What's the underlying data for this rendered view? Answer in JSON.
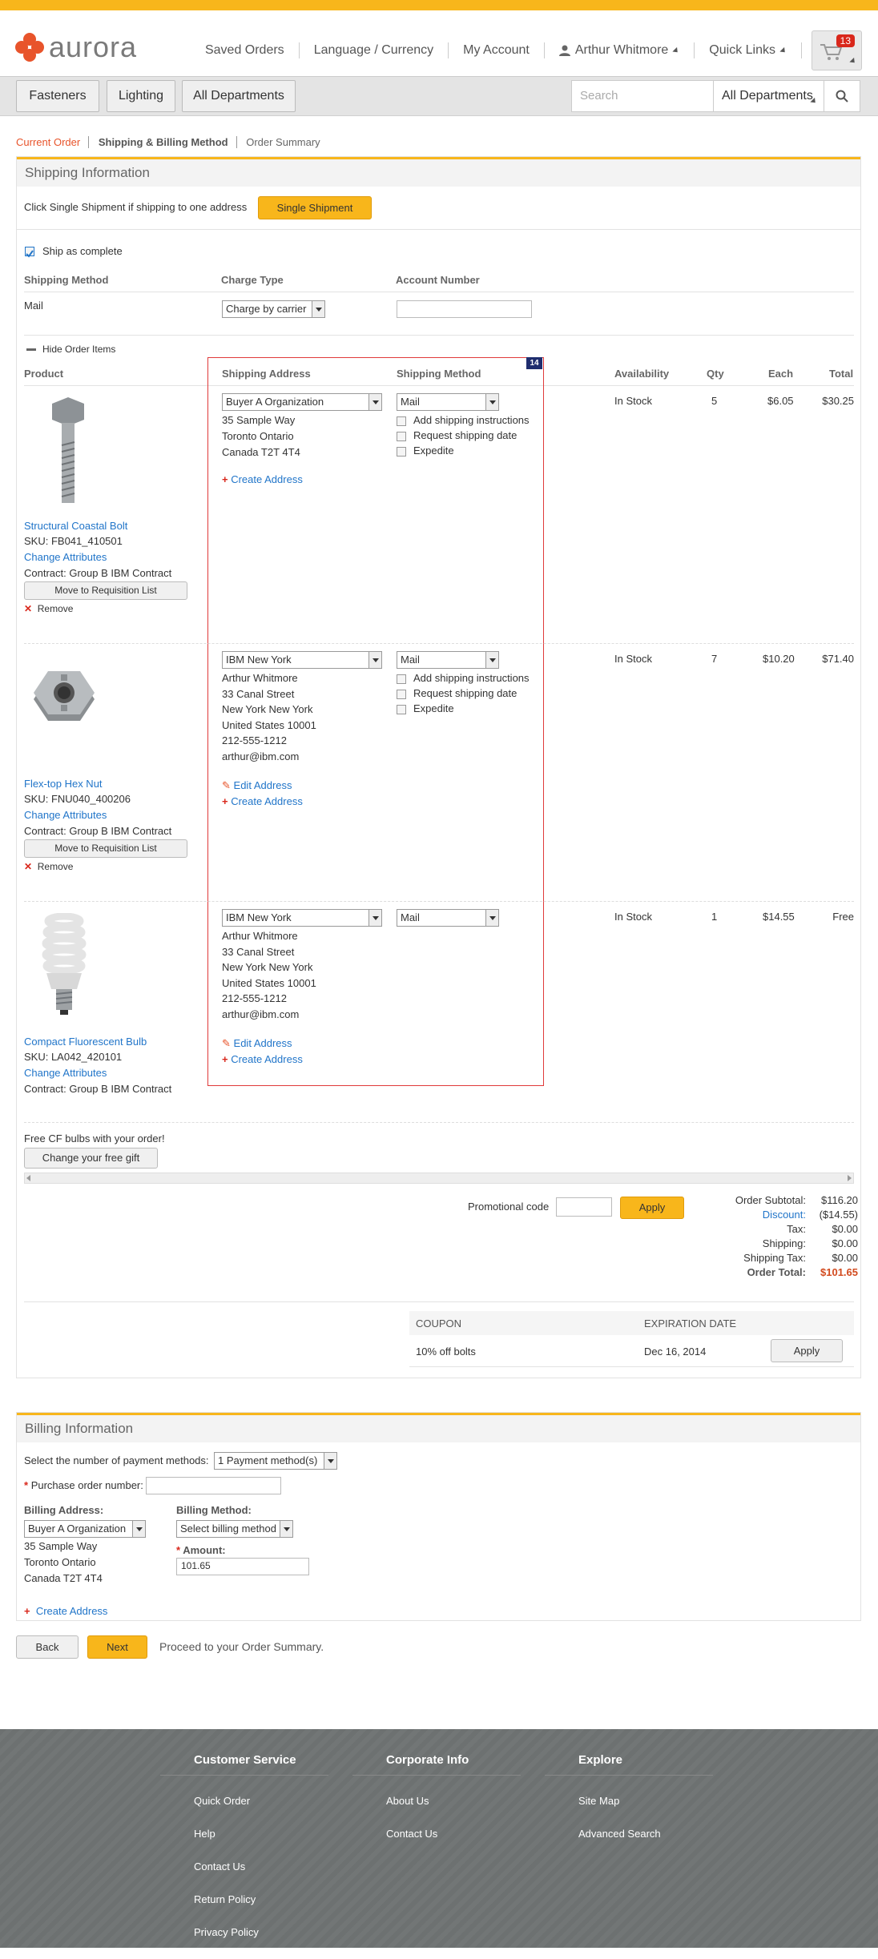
{
  "brand": {
    "name": "aurora"
  },
  "topnav": {
    "saved_orders": "Saved Orders",
    "language": "Language / Currency",
    "account": "My Account",
    "user": "Arthur Whitmore",
    "quick_links": "Quick Links",
    "cart_count": "13"
  },
  "categories": [
    "Fasteners",
    "Lighting",
    "All Departments"
  ],
  "search": {
    "placeholder": "Search",
    "dept": "All Departments"
  },
  "breadcrumb": [
    "Current Order",
    "Shipping & Billing Method",
    "Order Summary"
  ],
  "shipping": {
    "title": "Shipping Information",
    "single_prompt": "Click Single Shipment if shipping to one address",
    "single_btn": "Single Shipment",
    "ship_complete": "Ship as complete",
    "col_method": "Shipping Method",
    "col_charge": "Charge Type",
    "col_account": "Account Number",
    "method_val": "Mail",
    "charge_val": "Charge by carrier",
    "hide_items": "Hide Order Items",
    "cols": [
      "Product",
      "Shipping Address",
      "Shipping Method",
      "Availability",
      "Qty",
      "Each",
      "Total"
    ],
    "badge": "14",
    "items": [
      {
        "name": "Structural Coastal Bolt",
        "sku": "SKU: FB041_410501",
        "change": "Change Attributes",
        "contract": "Contract: Group B IBM Contract",
        "move": "Move to Requisition List",
        "remove": "Remove",
        "addr_sel": "Buyer A Organization",
        "addr": [
          "35 Sample Way",
          "Toronto Ontario",
          "Canada T2T 4T4"
        ],
        "edit": "",
        "create": "Create Address",
        "method": "Mail",
        "opts": [
          "Add shipping instructions",
          "Request shipping date",
          "Expedite"
        ],
        "avail": "In Stock",
        "qty": "5",
        "each": "$6.05",
        "total": "$30.25"
      },
      {
        "name": "Flex-top Hex Nut",
        "sku": "SKU: FNU040_400206",
        "change": "Change Attributes",
        "contract": "Contract: Group B IBM Contract",
        "move": "Move to Requisition List",
        "remove": "Remove",
        "addr_sel": "IBM New York",
        "addr": [
          "Arthur Whitmore",
          "33 Canal Street",
          "New York New York",
          "United States 10001",
          "212-555-1212",
          "arthur@ibm.com"
        ],
        "edit": "Edit Address",
        "create": "Create Address",
        "method": "Mail",
        "opts": [
          "Add shipping instructions",
          "Request shipping date",
          "Expedite"
        ],
        "avail": "In Stock",
        "qty": "7",
        "each": "$10.20",
        "total": "$71.40"
      },
      {
        "name": "Compact Fluorescent Bulb",
        "sku": "SKU: LA042_420101",
        "change": "Change Attributes",
        "contract": "Contract: Group B IBM Contract",
        "addr_sel": "IBM New York",
        "addr": [
          "Arthur Whitmore",
          "33 Canal Street",
          "New York New York",
          "United States 10001",
          "212-555-1212",
          "arthur@ibm.com"
        ],
        "edit": "Edit Address",
        "create": "Create Address",
        "method": "Mail",
        "avail": "In Stock",
        "qty": "1",
        "each": "$14.55",
        "total": "Free"
      }
    ],
    "gift_text": "Free CF bulbs with your order!",
    "gift_btn": "Change your free gift",
    "promo_label": "Promotional code",
    "promo_apply": "Apply",
    "totals": [
      {
        "k": "Order Subtotal:",
        "v": "$116.20"
      },
      {
        "k": "Discount:",
        "v": "($14.55)"
      },
      {
        "k": "Tax:",
        "v": "$0.00"
      },
      {
        "k": "Shipping:",
        "v": "$0.00"
      },
      {
        "k": "Shipping Tax:",
        "v": "$0.00"
      },
      {
        "k": "Order Total:",
        "v": "$101.65"
      }
    ],
    "coupon_head": "COUPON",
    "coupon_exp_head": "EXPIRATION DATE",
    "coupon": "10% off bolts",
    "coupon_date": "Dec 16, 2014",
    "coupon_apply": "Apply"
  },
  "billing": {
    "title": "Billing Information",
    "num_label": "Select the number of payment methods:",
    "num_val": "1 Payment method(s)",
    "po_label": "Purchase order number:",
    "addr_label": "Billing Address:",
    "addr_sel": "Buyer A Organization",
    "addr": [
      "35 Sample Way",
      "Toronto Ontario",
      "Canada T2T 4T4"
    ],
    "method_label": "Billing Method:",
    "method_sel": "Select billing method",
    "amount_label": "Amount:",
    "amount_val": "101.65",
    "create": "Create Address"
  },
  "nav": {
    "back": "Back",
    "next": "Next",
    "hint": "Proceed to your Order Summary."
  },
  "footer": {
    "cs": {
      "title": "Customer Service",
      "links": [
        "Quick Order",
        "Help",
        "Contact Us",
        "Return Policy",
        "Privacy Policy"
      ]
    },
    "ci": {
      "title": "Corporate Info",
      "links": [
        "About Us",
        "Contact Us"
      ]
    },
    "ex": {
      "title": "Explore",
      "links": [
        "Site Map",
        "Advanced Search"
      ]
    }
  },
  "colors": {
    "accent": "#f8b61b",
    "link": "#2175c9",
    "red": "#d9271b"
  }
}
